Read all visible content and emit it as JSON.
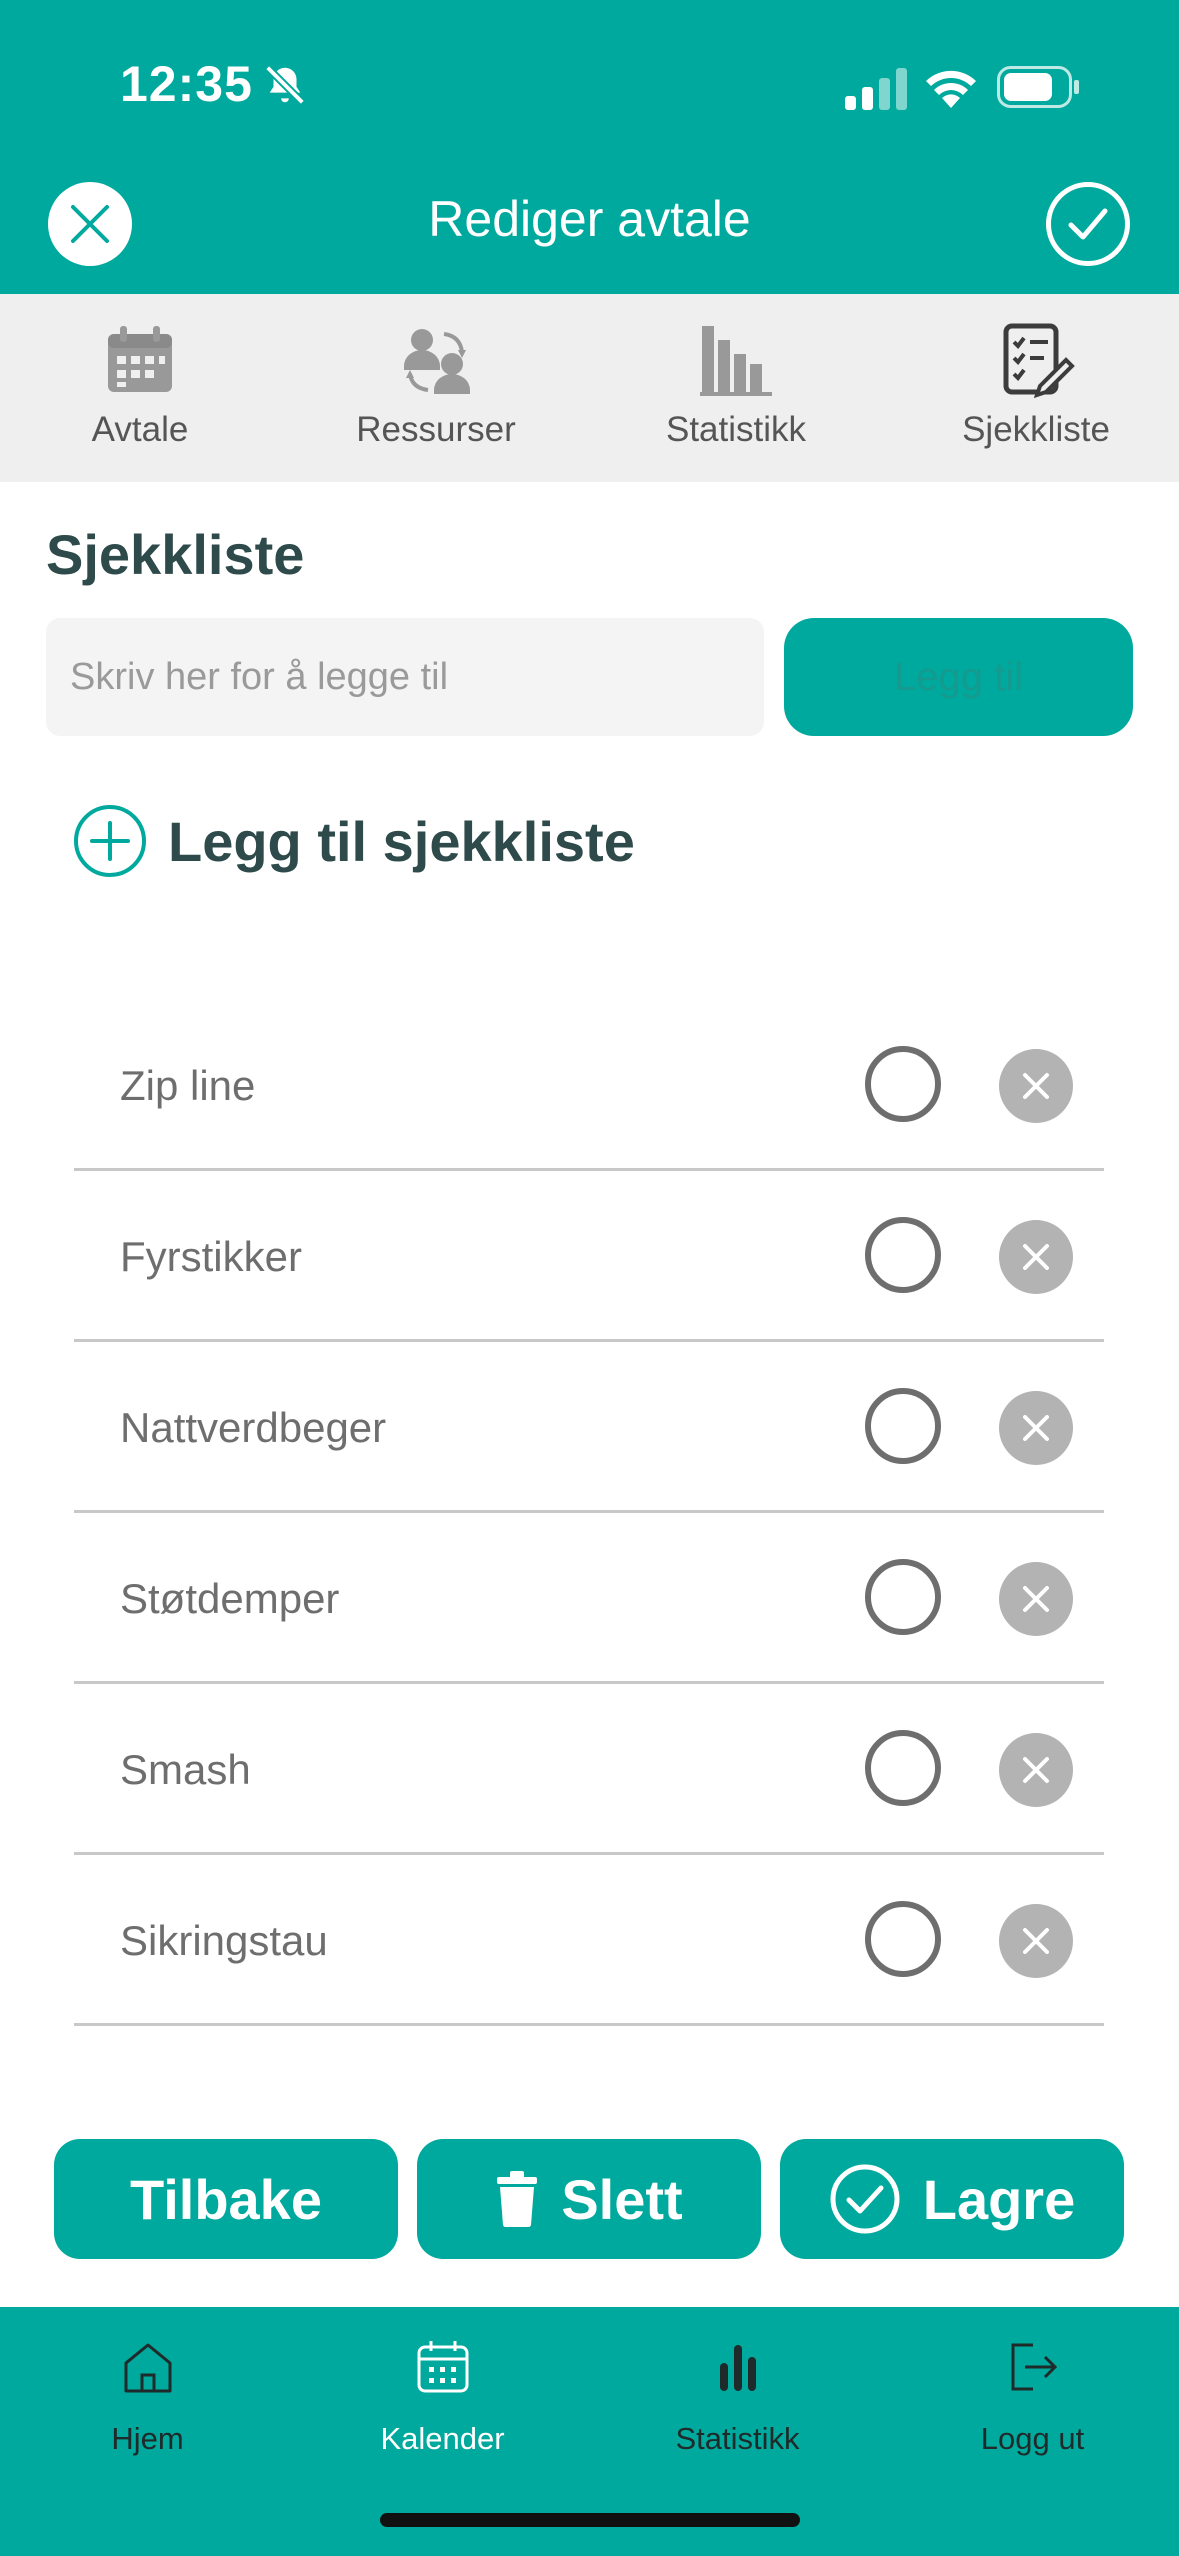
{
  "status_bar": {
    "time": "12:35"
  },
  "header": {
    "title": "Rediger avtale"
  },
  "tabs": [
    {
      "label": "Avtale",
      "icon": "calendar-icon"
    },
    {
      "label": "Ressurser",
      "icon": "resources-icon"
    },
    {
      "label": "Statistikk",
      "icon": "bar-chart-icon"
    },
    {
      "label": "Sjekkliste",
      "icon": "checklist-icon"
    }
  ],
  "checklist": {
    "title": "Sjekkliste",
    "input_placeholder": "Skriv her for å legge til",
    "input_value": "",
    "add_button_label": "Legg til",
    "add_checklist_label": "Legg til sjekkliste",
    "items": [
      {
        "label": "Zip line",
        "checked": false
      },
      {
        "label": "Fyrstikker",
        "checked": false
      },
      {
        "label": "Nattverdbeger",
        "checked": false
      },
      {
        "label": "Støtdemper",
        "checked": false
      },
      {
        "label": "Smash",
        "checked": false
      },
      {
        "label": "Sikringstau",
        "checked": false
      }
    ]
  },
  "actions": {
    "back_label": "Tilbake",
    "delete_label": "Slett",
    "save_label": "Lagre"
  },
  "bottom_nav": [
    {
      "label": "Hjem",
      "icon": "home-icon"
    },
    {
      "label": "Kalender",
      "icon": "calendar-icon"
    },
    {
      "label": "Statistikk",
      "icon": "stats-icon"
    },
    {
      "label": "Logg ut",
      "icon": "logout-icon"
    }
  ],
  "colors": {
    "brand": "#00a99d",
    "heading": "#2e4a4a",
    "active_nav_label": "#ffffff",
    "inactive_nav_label": "#1f2a2a",
    "tab_icon": "#999999",
    "tab_icon_active": "#3c3c3c"
  }
}
